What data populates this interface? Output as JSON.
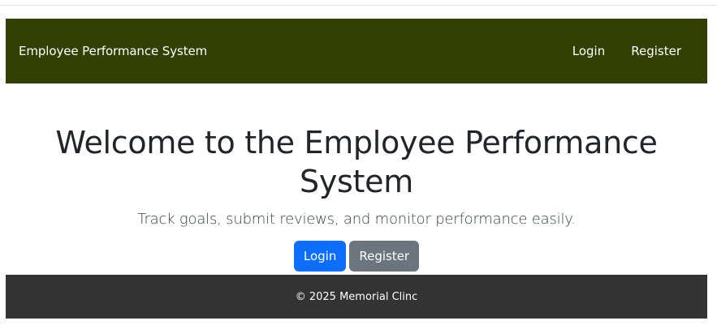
{
  "navbar": {
    "brand": "Employee Performance System",
    "links": [
      "Login",
      "Register"
    ]
  },
  "hero": {
    "title": "Welcome to the Employee Performance System",
    "lead": "Track goals, submit reviews, and monitor performance easily.",
    "primary_button": "Login",
    "secondary_button": "Register"
  },
  "footer": {
    "text": "© 2025 Memorial Clinc"
  },
  "colors": {
    "navbar_bg": "#334003",
    "primary": "#0d6efd",
    "secondary": "#6c757d",
    "footer_bg": "#333333"
  }
}
